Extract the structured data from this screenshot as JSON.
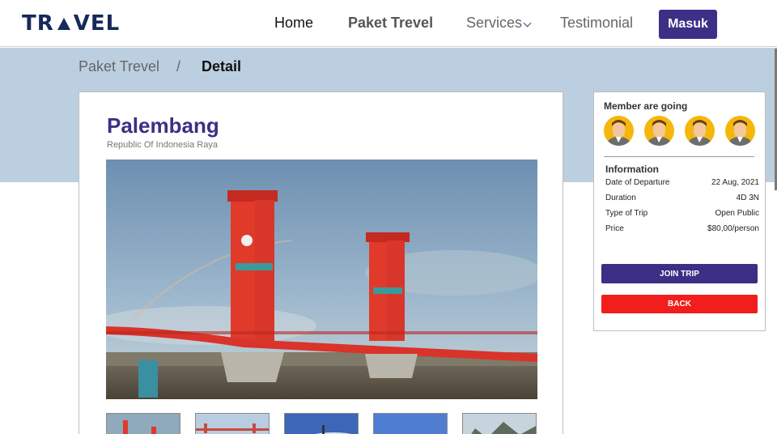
{
  "navbar": {
    "logo_left": "TR",
    "logo_right": "VEL",
    "links": {
      "home": "Home",
      "paket": "Paket Trevel",
      "services": "Services",
      "testimonial": "Testimonial"
    },
    "login_button": "Masuk"
  },
  "breadcrumb": {
    "parent": "Paket Trevel",
    "separator": "/",
    "current": "Detail"
  },
  "destination": {
    "title": "Palembang",
    "subtitle": "Republic Of Indonesia Raya"
  },
  "side": {
    "members_title": "Member are going",
    "info_title": "Information",
    "rows": [
      {
        "label": "Date of Departure",
        "value": "22 Aug, 2021"
      },
      {
        "label": "Duration",
        "value": "4D 3N"
      },
      {
        "label": "Type of Trip",
        "value": "Open Public"
      },
      {
        "label": "Price",
        "value": "$80,00/person"
      }
    ],
    "join_button": "JOIN TRIP",
    "back_button": "BACK"
  },
  "colors": {
    "brand": "#3b2f86",
    "logo": "#17295a",
    "hero_bg": "#bccfe0",
    "back_red": "#f21d1d",
    "avatar_bg": "#f4b70b"
  }
}
